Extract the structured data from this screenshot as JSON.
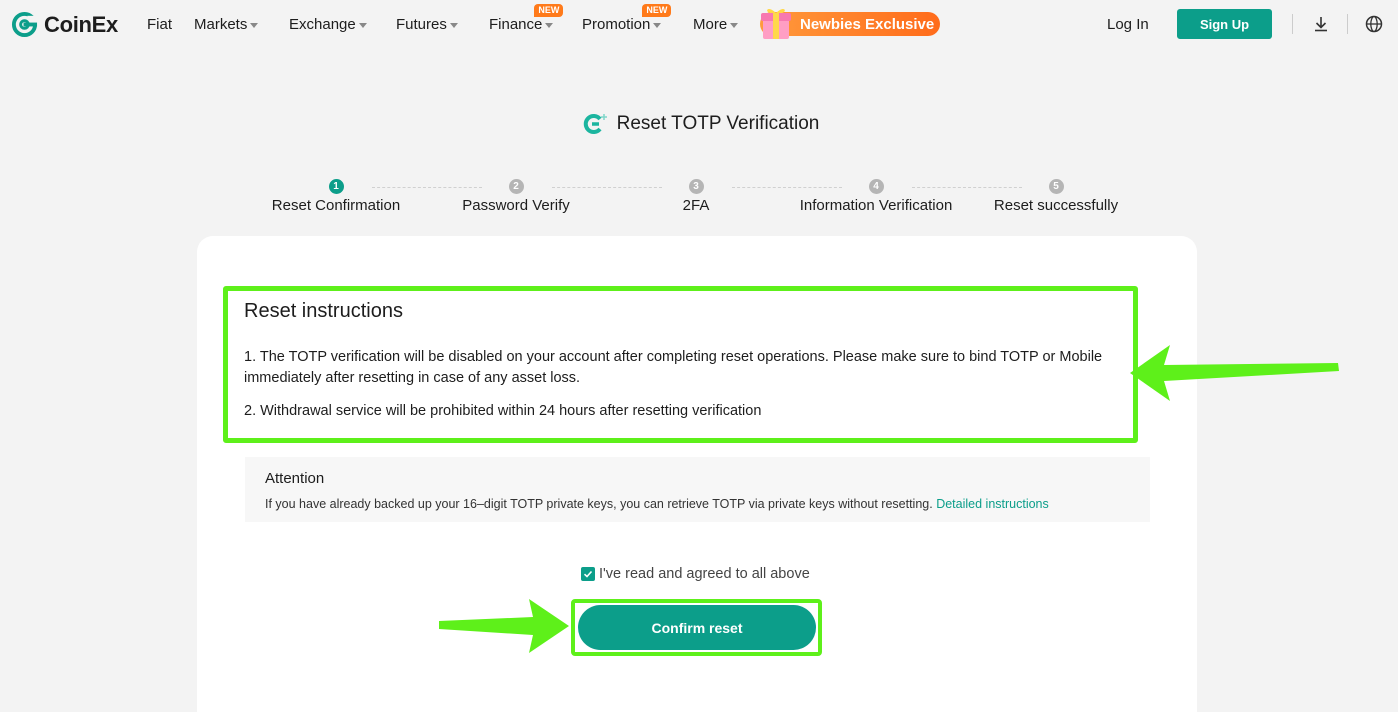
{
  "nav": {
    "brand": "CoinEx",
    "items": [
      {
        "label": "Fiat"
      },
      {
        "label": "Markets"
      },
      {
        "label": "Exchange"
      },
      {
        "label": "Futures"
      },
      {
        "label": "Finance",
        "badge": "NEW"
      },
      {
        "label": "Promotion",
        "badge": "NEW"
      },
      {
        "label": "More"
      }
    ],
    "promo_label": "Newbies Exclusive",
    "login_label": "Log In",
    "signup_label": "Sign Up",
    "icons": [
      "download-icon",
      "globe-icon"
    ]
  },
  "page": {
    "title": "Reset TOTP Verification",
    "title_icon": "google-authenticator-icon"
  },
  "steps": [
    {
      "number": "1",
      "label": "Reset Confirmation",
      "active": true
    },
    {
      "number": "2",
      "label": "Password Verify",
      "active": false
    },
    {
      "number": "3",
      "label": "2FA",
      "active": false
    },
    {
      "number": "4",
      "label": "Information Verification",
      "active": false
    },
    {
      "number": "5",
      "label": "Reset successfully",
      "active": false
    }
  ],
  "instructions": {
    "title": "Reset instructions",
    "items": [
      "1. The TOTP verification will be disabled on your account after completing reset operations. Please make sure to bind TOTP or Mobile immediately after resetting in case of any asset loss.",
      "2. Withdrawal service will be prohibited within 24 hours after resetting verification"
    ]
  },
  "attention": {
    "title": "Attention",
    "text": "If you have already backed up your 16–digit TOTP private keys, you can retrieve TOTP via private keys without resetting.",
    "link": "Detailed instructions"
  },
  "agreement": {
    "label": "I've read and agreed to all above",
    "checked": true
  },
  "confirm_label": "Confirm reset",
  "colors": {
    "brand": "#0c9e8a",
    "highlight": "#5ef01a",
    "badge": "#ff7a1a",
    "background": "#f3f3f3"
  }
}
